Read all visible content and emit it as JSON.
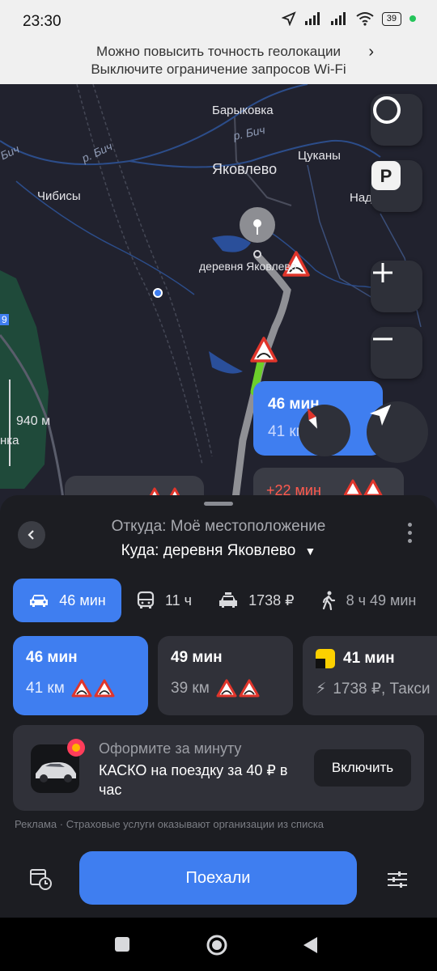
{
  "status": {
    "time": "23:30",
    "battery": "39"
  },
  "geo_banner": {
    "line1": "Можно повысить точность геолокации",
    "line2": "Выключите ограничение запросов Wi-Fi"
  },
  "map": {
    "labels": {
      "barykovka": "Барыковка",
      "river1": "р. Бич",
      "river2": "р. Бич",
      "river3": "Бич",
      "tsukany": "Цуканы",
      "yakovlevo": "Яковлево",
      "nade": "Наде",
      "chibisy": "Чибисы",
      "destination": "деревня Яковлево",
      "scale": "940 м",
      "nka": "нка",
      "road9": "9"
    },
    "bubble_main": {
      "time": "46 мин",
      "dist": "41 км"
    },
    "bubble_alt": {
      "delta": "+22 мин"
    }
  },
  "sheet": {
    "from": "Откуда: Моё местоположение",
    "to": "Куда: деревня Яковлево",
    "modes": [
      {
        "icon": "car-icon",
        "label": "46 мин"
      },
      {
        "icon": "bus-icon",
        "label": "11 ч"
      },
      {
        "icon": "taxi-icon",
        "label": "1738 ₽"
      },
      {
        "icon": "walk-icon",
        "label": "8 ч 49 мин"
      }
    ],
    "routes": [
      {
        "time": "46 мин",
        "dist": "41 км"
      },
      {
        "time": "49 мин",
        "dist": "39 км"
      },
      {
        "time": "41 мин",
        "dist": "1738 ₽, Такси"
      }
    ],
    "promo": {
      "subtitle": "Оформите за минуту",
      "title": "КАСКО на поездку за 40 ₽ в час",
      "button": "Включить"
    },
    "ad_note": "Реклама · Страховые услуги оказывают организации из списка",
    "go_button": "Поехали"
  },
  "colors": {
    "accent": "#3f7ef0",
    "map_bg": "#21222e",
    "sheet_bg": "#1c1d22",
    "card_bg": "#303139",
    "route_line": "#8f9095",
    "traffic_green": "#6ccf2a",
    "warning_red": "#e0352b"
  }
}
